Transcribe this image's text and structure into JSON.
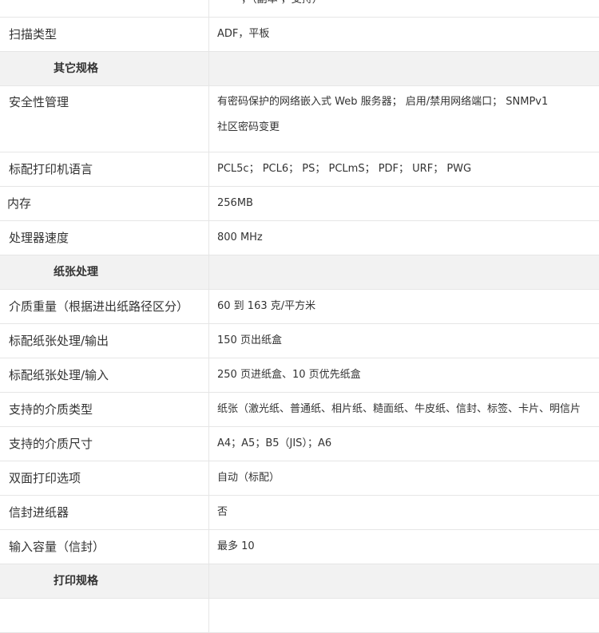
{
  "rows": [
    {
      "kind": "row",
      "label": "",
      "value": "—— ，（副本 ，支持）"
    },
    {
      "kind": "row",
      "label": "扫描类型",
      "value": "ADF，平板"
    },
    {
      "kind": "section",
      "label": "其它规格"
    },
    {
      "kind": "tall",
      "label": "安全性管理",
      "value_lines": [
        "有密码保护的网络嵌入式 Web 服务器； 启用/禁用网络端口； SNMPv1",
        "社区密码变更"
      ]
    },
    {
      "kind": "row",
      "label": "标配打印机语言",
      "value": "PCL5c； PCL6； PS； PCLmS； PDF； URF； PWG"
    },
    {
      "kind": "row",
      "label": "内存",
      "value": "256MB",
      "flush": true
    },
    {
      "kind": "row",
      "label": "处理器速度",
      "value": "800 MHz"
    },
    {
      "kind": "section",
      "label": "纸张处理"
    },
    {
      "kind": "row",
      "label": "介质重量（根据进出纸路径区分）",
      "value": "60 到 163 克/平方米"
    },
    {
      "kind": "row",
      "label": "标配纸张处理/输出",
      "value": "150 页出纸盒"
    },
    {
      "kind": "row",
      "label": "标配纸张处理/输入",
      "value": "250 页进纸盒、10 页优先纸盒"
    },
    {
      "kind": "row",
      "label": "支持的介质类型",
      "value": "纸张（激光纸、普通纸、相片纸、糙面纸、牛皮纸、信封、标签、卡片、明信片"
    },
    {
      "kind": "row",
      "label": "支持的介质尺寸",
      "value": "A4；A5；B5（JIS）；A6"
    },
    {
      "kind": "row",
      "label": "双面打印选项",
      "value": "自动（标配）"
    },
    {
      "kind": "row",
      "label": "信封进纸器",
      "value": "否"
    },
    {
      "kind": "row",
      "label": "输入容量（信封）",
      "value": "最多 10"
    },
    {
      "kind": "section",
      "label": "打印规格"
    }
  ]
}
